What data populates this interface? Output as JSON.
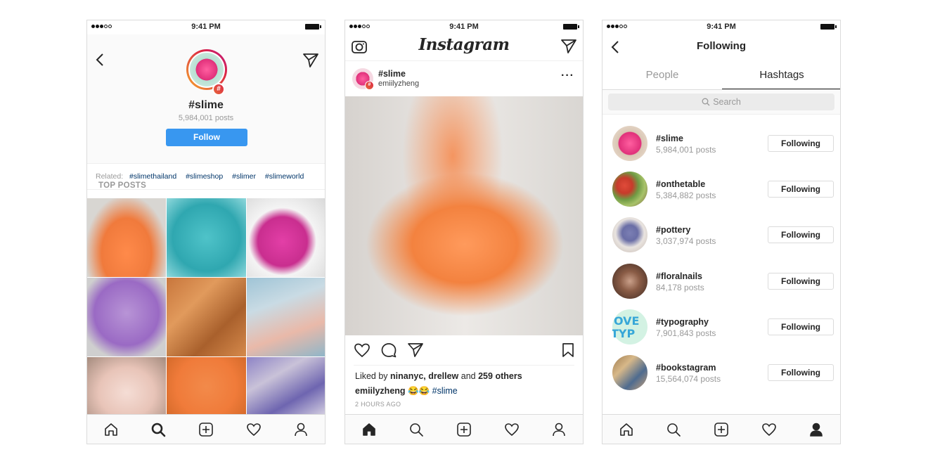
{
  "status": {
    "time": "9:41 PM"
  },
  "hashtag_page": {
    "name": "#slime",
    "posts": "5,984,001 posts",
    "follow_label": "Follow",
    "badge": "#",
    "related_label": "Related:",
    "related": [
      "#slimethailand",
      "#slimeshop",
      "#slimer",
      "#slimeworld"
    ],
    "top_posts_label": "TOP POSTS"
  },
  "feed": {
    "logo": "Instagram",
    "post": {
      "hashtag": "#slime",
      "user": "emiilyzheng",
      "likes_prefix": "Liked by ",
      "likes_users": "ninanyc, drellew",
      "likes_mid": " and ",
      "likes_others": "259 others",
      "caption_user": "emiilyzheng",
      "caption_emoji": " 😂😂 ",
      "caption_tag": "#slime",
      "time_ago": "2 HOURS AGO"
    }
  },
  "following": {
    "title": "Following",
    "tabs": [
      "People",
      "Hashtags"
    ],
    "search_placeholder": "Search",
    "button_label": "Following",
    "items": [
      {
        "name": "#slime",
        "posts": "5,984,001 posts"
      },
      {
        "name": "#onthetable",
        "posts": "5,384,882 posts"
      },
      {
        "name": "#pottery",
        "posts": "3,037,974 posts"
      },
      {
        "name": "#floralnails",
        "posts": "84,178 posts"
      },
      {
        "name": "#typography",
        "posts": "7,901,843 posts"
      },
      {
        "name": "#bookstagram",
        "posts": "15,564,074 posts"
      }
    ]
  },
  "icons": [
    "back-arrow-icon",
    "send-icon",
    "camera-icon",
    "more-icon",
    "heart-icon",
    "comment-icon",
    "bookmark-icon",
    "home-icon",
    "search-icon",
    "add-icon",
    "profile-icon"
  ]
}
